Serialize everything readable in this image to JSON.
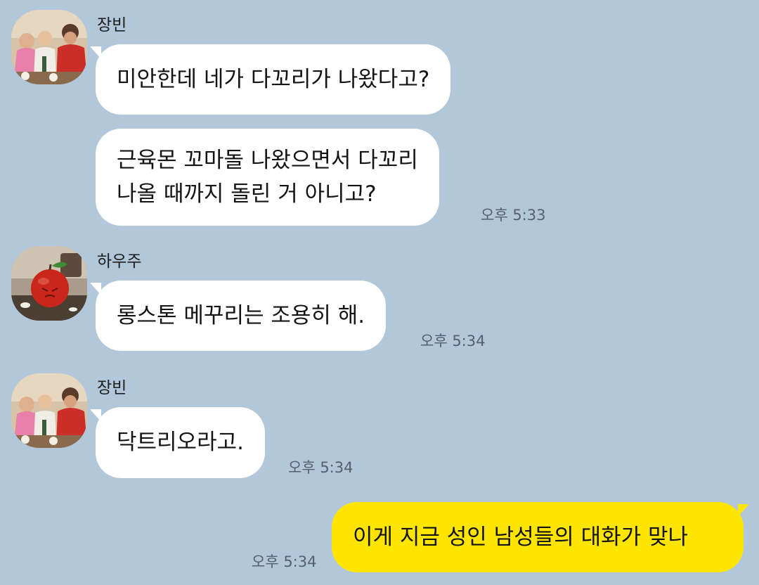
{
  "messages": [
    {
      "sender": "장빈",
      "lines": [
        "미안한데 네가 다꼬리가 나왔다고?"
      ],
      "time": ""
    },
    {
      "sender": "",
      "lines": [
        "근육몬 꼬마돌 나왔으면서 다꼬리",
        "나올 때까지 돌린 거 아니고?"
      ],
      "time": "오후 5:33"
    },
    {
      "sender": "하우주",
      "lines": [
        "롱스톤 메꾸리는 조용히 해."
      ],
      "time": "오후 5:34"
    },
    {
      "sender": "장빈",
      "lines": [
        "닥트리오라고."
      ],
      "time": "오후 5:34"
    },
    {
      "sender": "me",
      "lines": [
        "이게 지금 성인 남성들의 대화가 맞나"
      ],
      "time": "오후 5:34"
    }
  ],
  "colors": {
    "background": "#b2c7da",
    "incoming_bubble": "#ffffff",
    "outgoing_bubble": "#fee500",
    "timestamp": "#55606c"
  }
}
